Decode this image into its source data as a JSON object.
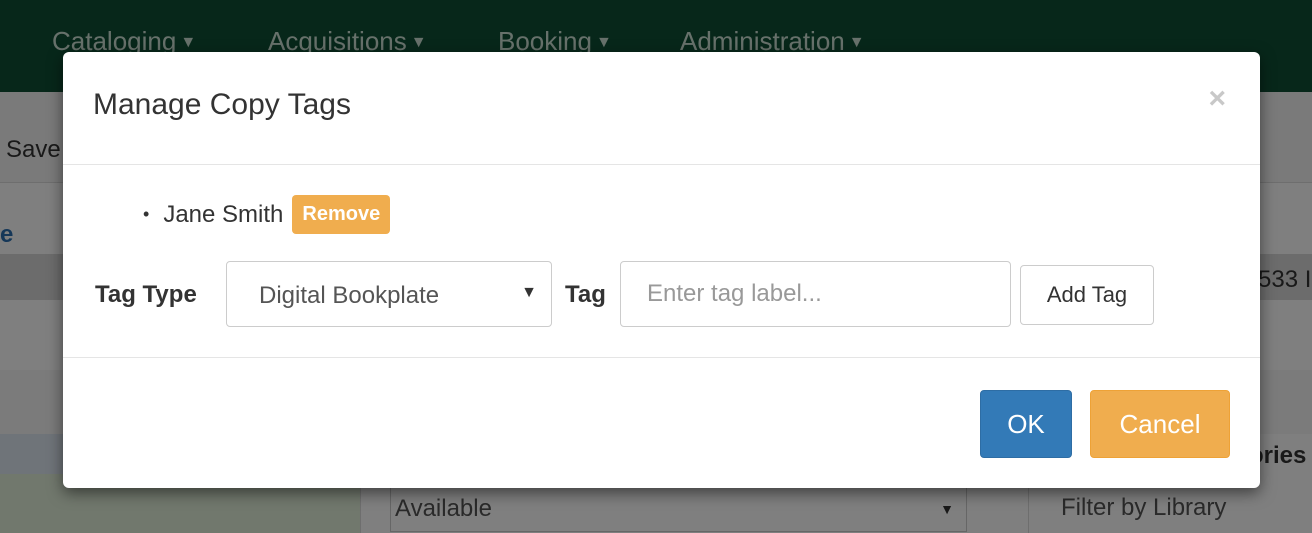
{
  "navbar": {
    "items": [
      {
        "label": "Cataloging"
      },
      {
        "label": "Acquisitions"
      },
      {
        "label": "Booking"
      },
      {
        "label": "Administration"
      }
    ]
  },
  "background": {
    "save_fragment": "Save",
    "link_fragment": "e",
    "count_fragment": "533 I",
    "categories_fragment": "ories",
    "status_value": "Available",
    "filter_label": "Filter by Library"
  },
  "modal": {
    "title": "Manage Copy Tags",
    "close_glyph": "×",
    "tags": [
      {
        "label": "Jane Smith",
        "remove_label": "Remove"
      }
    ],
    "tag_type_label": "Tag Type",
    "tag_type_selected": "Digital Bookplate",
    "tag_label": "Tag",
    "tag_input_placeholder": "Enter tag label...",
    "tag_input_value": "",
    "add_tag_label": "Add Tag",
    "ok_label": "OK",
    "cancel_label": "Cancel"
  },
  "colors": {
    "navbar": "#0f4f35",
    "primary": "#337ab7",
    "warning": "#f0ad4e"
  }
}
